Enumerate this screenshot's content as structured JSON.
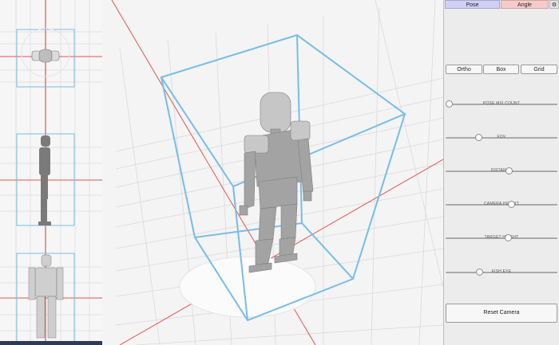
{
  "tabs": {
    "pose": "Pose",
    "angle": "Angle",
    "settings_icon": "gear-icon",
    "settings_glyph": "⚙"
  },
  "view_buttons": {
    "ortho": "Ortho",
    "box": "Box",
    "grid": "Grid"
  },
  "sliders": [
    {
      "label": "POSE MIX COUNT",
      "value": 0.0
    },
    {
      "label": "FOV",
      "value": 0.28
    },
    {
      "label": "DISTANCE",
      "value": 0.57
    },
    {
      "label": "CAMERA HEIGHT",
      "value": 0.59
    },
    {
      "label": "TARGET HEIGHT",
      "value": 0.56
    },
    {
      "label": "FISH EYE",
      "value": 0.29
    }
  ],
  "reset_camera": "Reset Camera",
  "colors": {
    "background": "#f4f4f4",
    "grid": "#dadada",
    "axis": "#e0544e",
    "bounding_box": "#76bde8",
    "mannequin": "#9c9c9c",
    "tab_pose": "#cfcff8",
    "tab_angle": "#f7caca"
  }
}
